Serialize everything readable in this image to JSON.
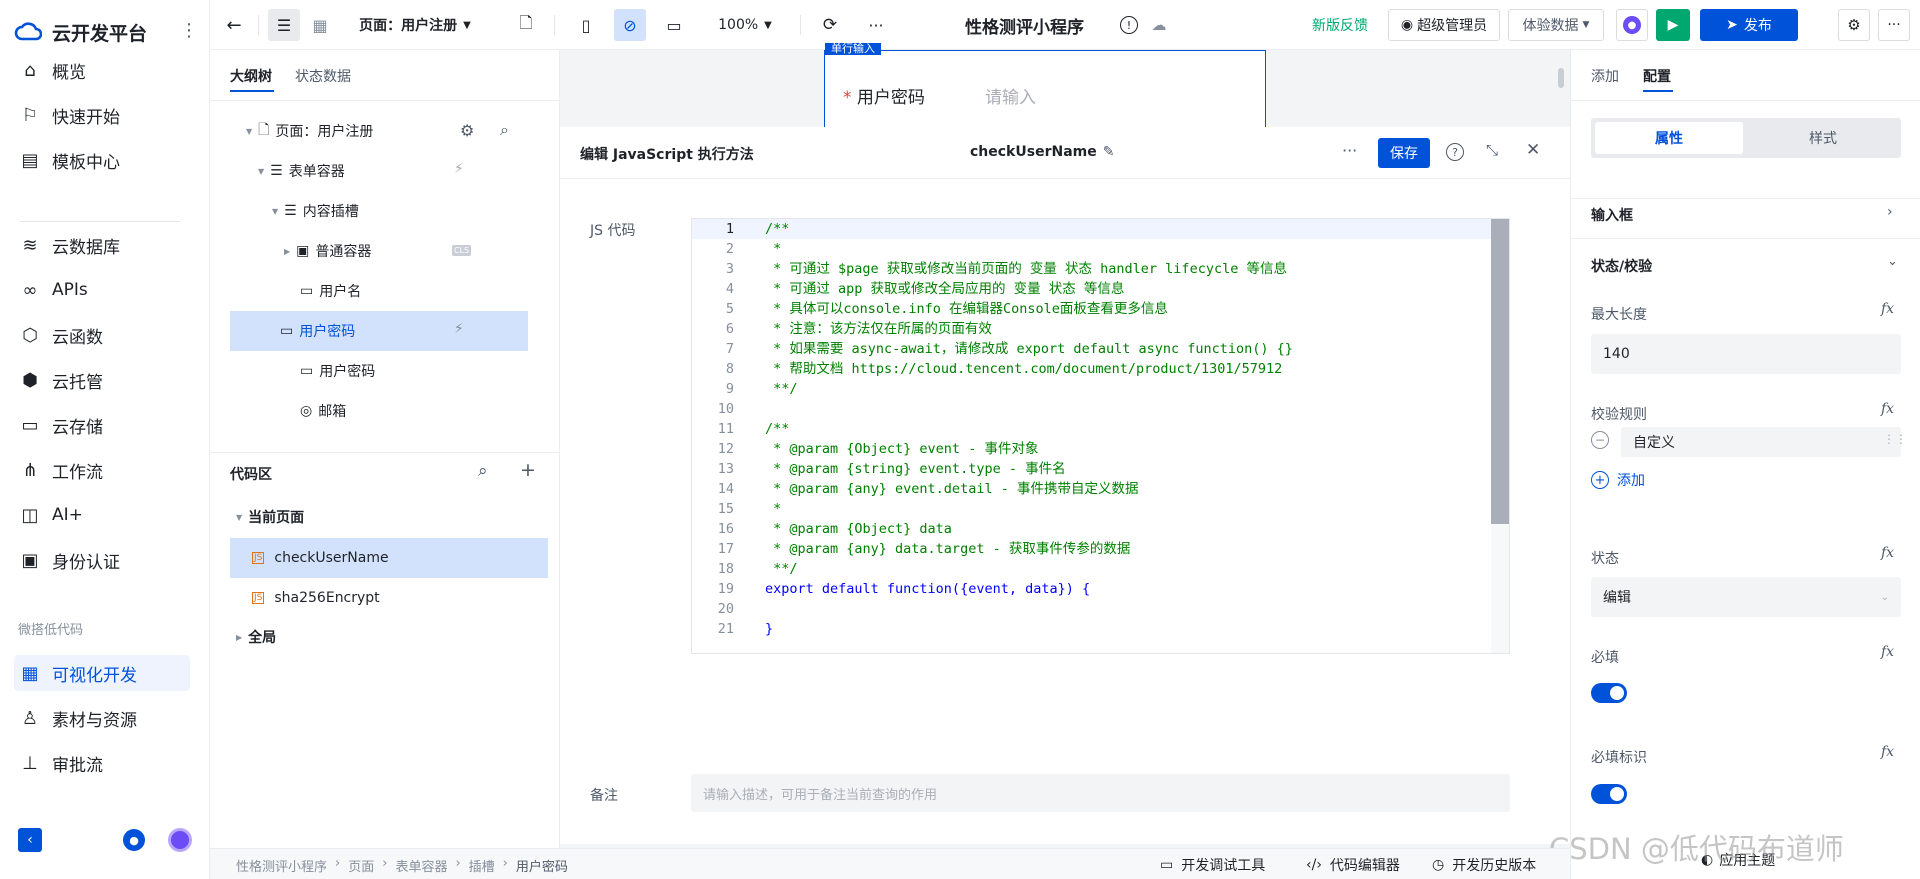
{
  "app": {
    "name": "云开发平台"
  },
  "nav": {
    "items": [
      {
        "label": "概览",
        "icon": "home-icon"
      },
      {
        "label": "快速开始",
        "icon": "flag-icon"
      },
      {
        "label": "模板中心",
        "icon": "template-icon"
      },
      {
        "label": "云数据库",
        "icon": "database-icon"
      },
      {
        "label": "APIs",
        "icon": "link-icon"
      },
      {
        "label": "云函数",
        "icon": "function-icon"
      },
      {
        "label": "云托管",
        "icon": "hexagon-icon"
      },
      {
        "label": "云存储",
        "icon": "folder-icon"
      },
      {
        "label": "工作流",
        "icon": "workflow-icon"
      },
      {
        "label": "AI+",
        "icon": "robot-icon"
      },
      {
        "label": "身份认证",
        "icon": "id-card-icon"
      }
    ],
    "section_label": "微搭低代码",
    "lowcode_items": [
      {
        "label": "可视化开发",
        "icon": "layout-icon"
      },
      {
        "label": "素材与资源",
        "icon": "assets-icon"
      },
      {
        "label": "审批流",
        "icon": "stamp-icon"
      }
    ]
  },
  "toolbar": {
    "page_label": "页面：用户注册",
    "zoom": "100%",
    "app_title": "性格测评小程序",
    "feedback": "新版反馈",
    "admin": "超级管理员",
    "data_mode": "体验数据",
    "publish": "发布"
  },
  "outline": {
    "tabs": [
      "大纲树",
      "状态数据"
    ],
    "tree": [
      {
        "label": "页面：用户注册"
      },
      {
        "label": "表单容器"
      },
      {
        "label": "内容插槽"
      },
      {
        "label": "普通容器",
        "badge": "CLS"
      },
      {
        "label": "用户名"
      },
      {
        "label": "用户密码"
      },
      {
        "label": "用户密码"
      },
      {
        "label": "邮箱"
      }
    ],
    "code_title": "代码区",
    "current_page": "当前页面",
    "code_items": [
      "checkUserName",
      "sha256Encrypt"
    ],
    "global": "全局"
  },
  "canvas": {
    "field_tag": "单行输入",
    "field_label": "用户密码",
    "field_required": "*",
    "field_placeholder": "请输入"
  },
  "editor": {
    "title": "编辑 JavaScript 执行方法",
    "method_name": "checkUserName",
    "save": "保存",
    "js_label": "JS 代码",
    "note_label": "备注",
    "note_placeholder": "请输入描述，可用于备注当前查询的作用",
    "lines": [
      "/**",
      " *",
      " * 可通过 $page 获取或修改当前页面的 变量 状态 handler lifecycle 等信息",
      " * 可通过 app 获取或修改全局应用的 变量 状态 等信息",
      " * 具体可以console.info 在编辑器Console面板查看更多信息",
      " * 注意：该方法仅在所属的页面有效",
      " * 如果需要 async-await，请修改成 export default async function() {}",
      " * 帮助文档 https://cloud.tencent.com/document/product/1301/57912",
      " **/",
      "",
      "/**",
      " * @param {Object} event - 事件对象",
      " * @param {string} event.type - 事件名",
      " * @param {any} event.detail - 事件携带自定义数据",
      " *",
      " * @param {Object} data",
      " * @param {any} data.target - 获取事件传参的数据",
      " **/",
      "export default function({event, data}) {",
      "",
      "}"
    ],
    "line_numbers": [
      "1",
      "2",
      "3",
      "4",
      "5",
      "6",
      "7",
      "8",
      "9",
      "10",
      "11",
      "12",
      "13",
      "14",
      "15",
      "16",
      "17",
      "18",
      "19",
      "20",
      "21"
    ]
  },
  "right": {
    "tabs": [
      "添加",
      "配置"
    ],
    "seg": [
      "属性",
      "样式"
    ],
    "input_section": "输入框",
    "status_section": "状态/校验",
    "maxlen_label": "最大长度",
    "maxlen_value": "140",
    "rule_label": "校验规则",
    "rule_value": "自定义",
    "add_label": "添加",
    "state_label": "状态",
    "state_value": "编辑",
    "required_label": "必填",
    "required_mark_label": "必填标识",
    "fx": "fx",
    "required_on": true,
    "required_mark_on": true
  },
  "statusbar": {
    "crumbs": [
      "性格测评小程序",
      "页面",
      "表单容器",
      "插槽",
      "用户密码"
    ],
    "tools": [
      "开发调试工具",
      "代码编辑器",
      "开发历史版本"
    ],
    "theme": "应用主题",
    "watermark": "CSDN @低代码布道师"
  },
  "colors": {
    "accent": "#0052d9",
    "green": "#00a870",
    "comment": "#008000",
    "selected": "#d3e2fc"
  }
}
